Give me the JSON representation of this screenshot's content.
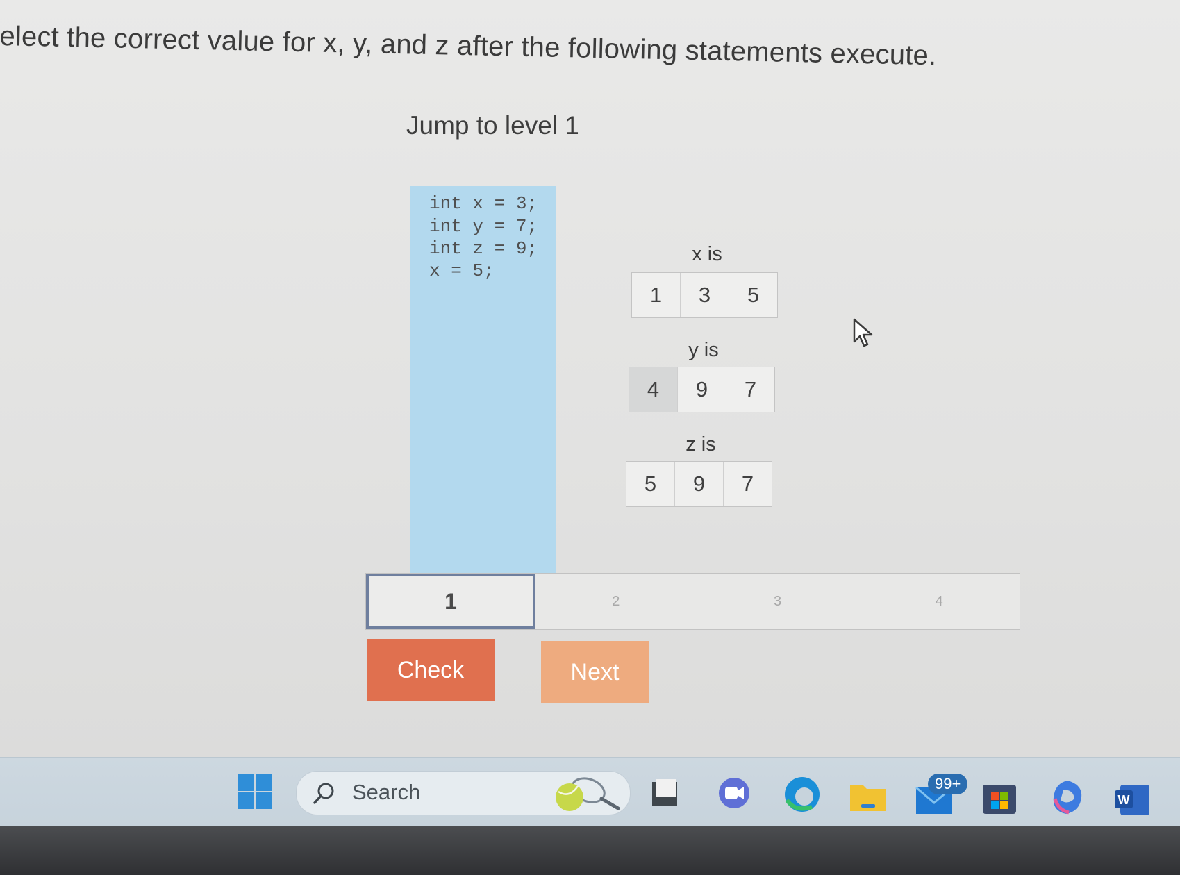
{
  "instruction": "elect the correct value for x, y, and z after the following statements execute.",
  "level_title": "Jump to level 1",
  "code": {
    "line1": "int x = 3;",
    "line2": "int y = 7;",
    "line3": "int z = 9;",
    "line4": "x = 5;"
  },
  "questions": {
    "x": {
      "label": "x is",
      "options": [
        "1",
        "3",
        "5"
      ]
    },
    "y": {
      "label": "y is",
      "options": [
        "4",
        "9",
        "7"
      ],
      "selected": "4"
    },
    "z": {
      "label": "z is",
      "options": [
        "5",
        "9",
        "7"
      ]
    }
  },
  "progress": {
    "steps": [
      "1",
      "2",
      "3",
      "4"
    ],
    "current": "1"
  },
  "buttons": {
    "check": "Check",
    "next": "Next"
  },
  "taskbar": {
    "search_label": "Search",
    "mail_badge": "99+",
    "icons": [
      "windows-start-icon",
      "search-icon",
      "tennis-widget-icon",
      "file-explorer-icon",
      "video-call-icon",
      "edge-browser-icon",
      "folder-icon",
      "mail-icon",
      "store-icon",
      "copilot-icon",
      "word-icon"
    ]
  },
  "colors": {
    "code_panel": "#b3d9ee",
    "check_button": "#e0704f",
    "next_button": "#eeab7f",
    "active_step_border": "#6f7f9e"
  }
}
